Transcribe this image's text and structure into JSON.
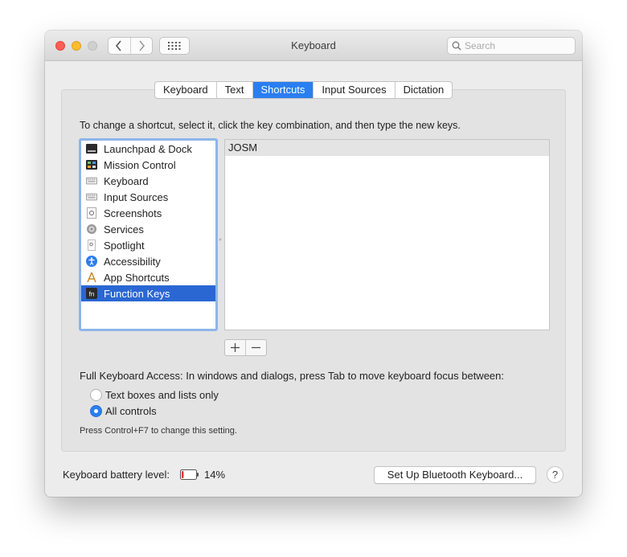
{
  "window": {
    "title": "Keyboard",
    "search_placeholder": "Search"
  },
  "tabs": [
    {
      "label": "Keyboard",
      "active": false
    },
    {
      "label": "Text",
      "active": false
    },
    {
      "label": "Shortcuts",
      "active": true
    },
    {
      "label": "Input Sources",
      "active": false
    },
    {
      "label": "Dictation",
      "active": false
    }
  ],
  "instruction": "To change a shortcut, select it, click the key combination, and then type the new keys.",
  "categories": [
    {
      "label": "Launchpad & Dock",
      "icon": "launchpad-dock-icon"
    },
    {
      "label": "Mission Control",
      "icon": "mission-control-icon"
    },
    {
      "label": "Keyboard",
      "icon": "keyboard-icon"
    },
    {
      "label": "Input Sources",
      "icon": "input-sources-icon"
    },
    {
      "label": "Screenshots",
      "icon": "screenshots-icon"
    },
    {
      "label": "Services",
      "icon": "gear-icon"
    },
    {
      "label": "Spotlight",
      "icon": "spotlight-icon"
    },
    {
      "label": "Accessibility",
      "icon": "accessibility-icon"
    },
    {
      "label": "App Shortcuts",
      "icon": "app-shortcuts-icon"
    },
    {
      "label": "Function Keys",
      "icon": "fn-icon",
      "selected": true
    }
  ],
  "shortcuts": [
    {
      "label": "JOSM"
    }
  ],
  "buttons": {
    "add": "+",
    "remove": "−",
    "bluetooth_keyboard": "Set Up Bluetooth Keyboard...",
    "help": "?"
  },
  "full_keyboard_access": {
    "label": "Full Keyboard Access: In windows and dialogs, press Tab to move keyboard focus between:",
    "options": [
      {
        "label": "Text boxes and lists only",
        "selected": false
      },
      {
        "label": "All controls",
        "selected": true
      }
    ],
    "hint": "Press Control+F7 to change this setting."
  },
  "battery": {
    "label": "Keyboard battery level:",
    "percent_text": "14%",
    "level": 0.14
  },
  "colors": {
    "accent": "#2a7ef0",
    "selection": "#2a67d3",
    "battery_low": "#e0322c"
  }
}
